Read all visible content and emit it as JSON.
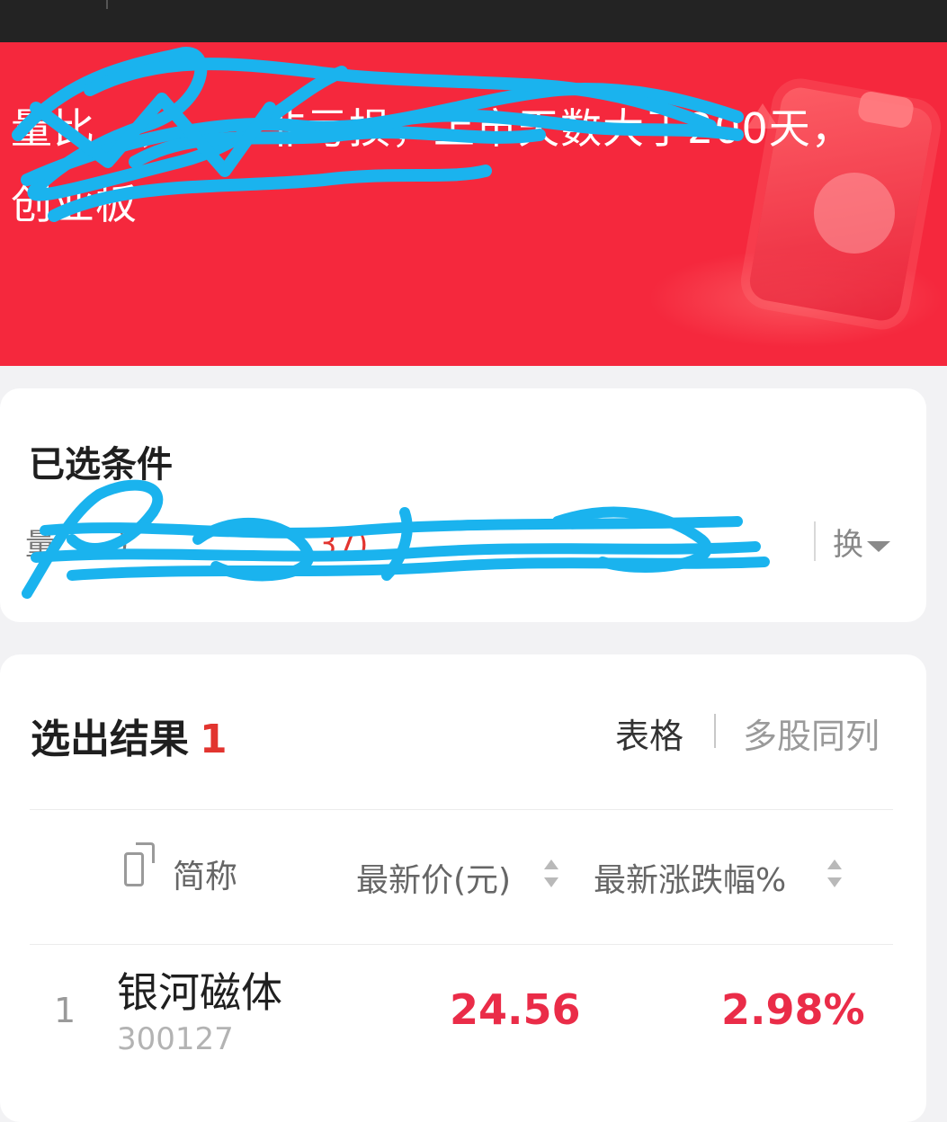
{
  "header": {
    "query_text": "量比…，…，非亏损，上市天数大于200天，创业板",
    "redaction_color": "#1ab3ee",
    "hero_color": "#f5283d"
  },
  "conditions": {
    "title": "已选条件",
    "tags_left": "量……)",
    "tags_right": "……37)",
    "switch_label": "换"
  },
  "results": {
    "title": "选出结果",
    "count": "1",
    "view_table": "表格",
    "view_multi": "多股同列",
    "columns": {
      "name": "简称",
      "price": "最新价(元)",
      "change": "最新涨跌幅%"
    },
    "rows": [
      {
        "index": "1",
        "name": "银河磁体",
        "code": "300127",
        "price": "24.56",
        "change": "2.98%"
      }
    ],
    "accent_color": "#ea2c48"
  }
}
